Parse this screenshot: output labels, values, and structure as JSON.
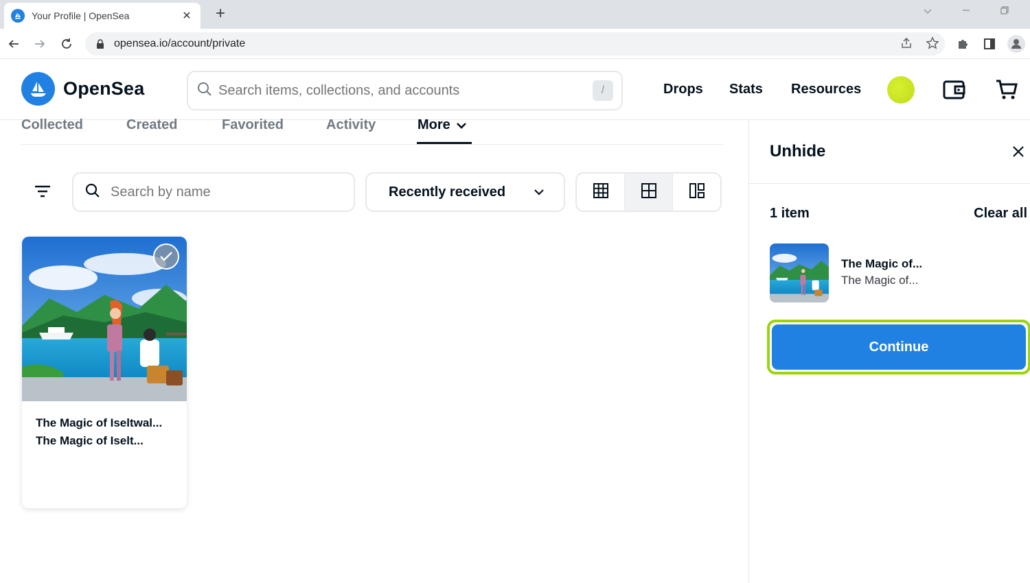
{
  "browser": {
    "tab_title": "Your Profile | OpenSea",
    "tab_close": "✕",
    "new_tab": "+",
    "url": "opensea.io/account/private"
  },
  "header": {
    "logo_text": "OpenSea",
    "search_placeholder": "Search items, collections, and accounts",
    "search_shortcut": "/",
    "nav": [
      "Drops",
      "Stats",
      "Resources"
    ]
  },
  "profile_tabs": [
    {
      "label": "Collected"
    },
    {
      "label": "Created"
    },
    {
      "label": "Favorited"
    },
    {
      "label": "Activity"
    },
    {
      "label": "More"
    }
  ],
  "filters": {
    "search_placeholder": "Search by name",
    "sort_label": "Recently received"
  },
  "card": {
    "title": "The Magic of Iseltwal...",
    "subtitle": "The Magic of Iselt..."
  },
  "panel": {
    "title": "Unhide",
    "count": "1 item",
    "clear_all": "Clear all",
    "item_title": "The Magic of...",
    "item_subtitle": "The Magic of...",
    "continue_label": "Continue"
  },
  "colors": {
    "brand_blue": "#2081e2",
    "highlight_green": "#9bd30f",
    "avatar_yellow": "#cfe625"
  }
}
